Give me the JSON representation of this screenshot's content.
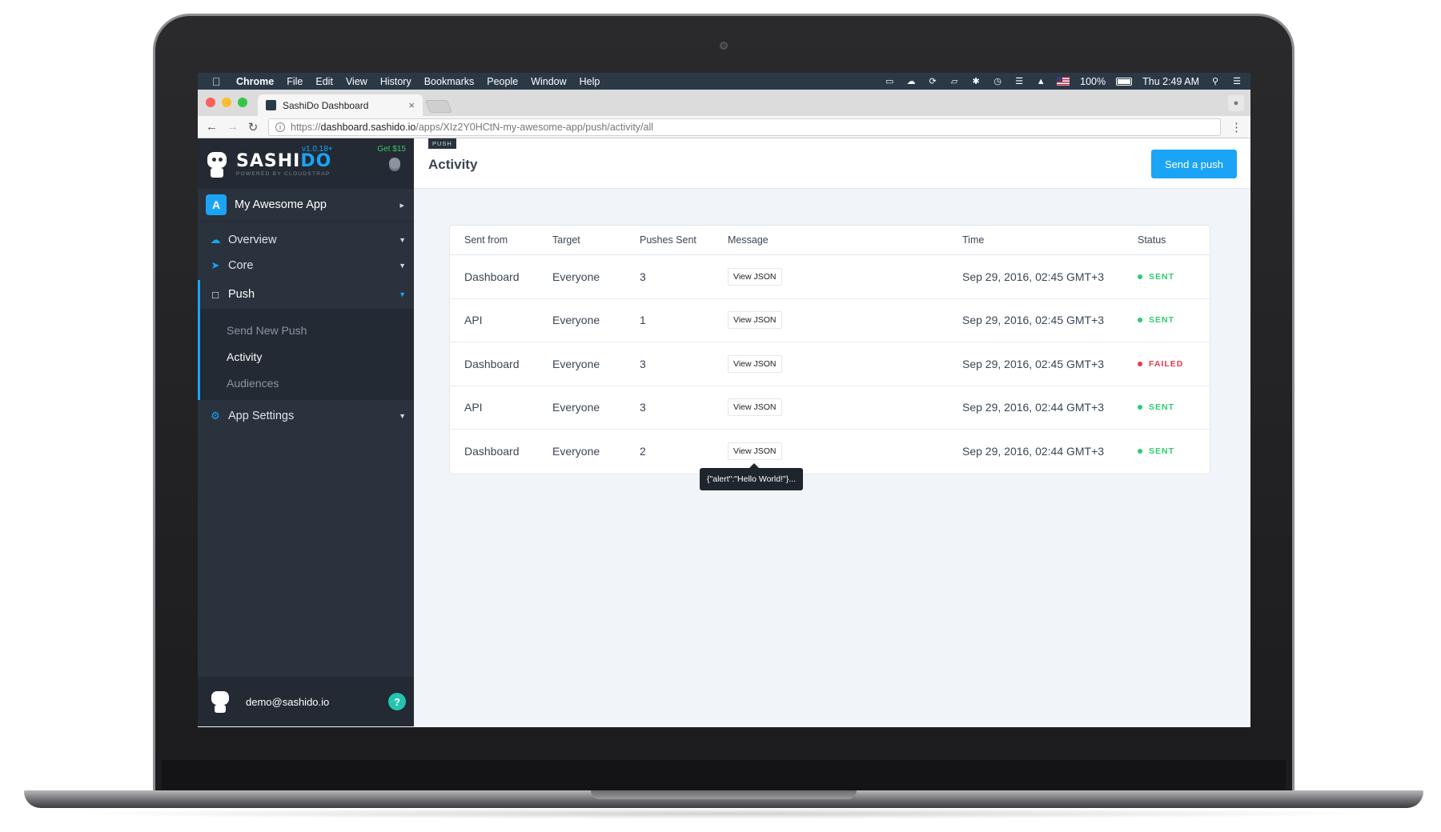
{
  "menubar": {
    "app": "Chrome",
    "items": [
      "File",
      "Edit",
      "View",
      "History",
      "Bookmarks",
      "People",
      "Window",
      "Help"
    ],
    "battery": "100%",
    "clock": "Thu 2:49 AM"
  },
  "browser": {
    "tab_title": "SashiDo Dashboard",
    "url_scheme": "https://",
    "url_host": "dashboard.sashido.io",
    "url_path": "/apps/XIz2Y0HCtN-my-awesome-app/push/activity/all"
  },
  "sidebar": {
    "brand": {
      "name_a": "SASHI",
      "name_b": "DO",
      "powered": "POWERED BY CLOUDSTRAP",
      "version": "v1.0.18+",
      "credit": "Get $15"
    },
    "app_name": "My Awesome App",
    "nav": [
      {
        "label": "Overview"
      },
      {
        "label": "Core"
      },
      {
        "label": "Push"
      },
      {
        "label": "App Settings"
      }
    ],
    "subnav": [
      {
        "label": "Send New Push"
      },
      {
        "label": "Activity"
      },
      {
        "label": "Audiences"
      }
    ],
    "user_email": "demo@sashido.io",
    "help": "?"
  },
  "header": {
    "section": "PUSH",
    "title": "Activity",
    "action": "Send a push"
  },
  "table": {
    "columns": [
      "Sent from",
      "Target",
      "Pushes Sent",
      "Message",
      "Time",
      "Status"
    ],
    "view_label": "View JSON",
    "rows": [
      {
        "from": "Dashboard",
        "target": "Everyone",
        "pushes": "3",
        "time": "Sep 29, 2016, 02:45 GMT+3",
        "status": "SENT"
      },
      {
        "from": "API",
        "target": "Everyone",
        "pushes": "1",
        "time": "Sep 29, 2016, 02:45 GMT+3",
        "status": "SENT"
      },
      {
        "from": "Dashboard",
        "target": "Everyone",
        "pushes": "3",
        "time": "Sep 29, 2016, 02:45 GMT+3",
        "status": "FAILED"
      },
      {
        "from": "API",
        "target": "Everyone",
        "pushes": "3",
        "time": "Sep 29, 2016, 02:44 GMT+3",
        "status": "SENT"
      },
      {
        "from": "Dashboard",
        "target": "Everyone",
        "pushes": "2",
        "time": "Sep 29, 2016, 02:44 GMT+3",
        "status": "SENT"
      }
    ]
  },
  "tooltip": "{\"alert\":\"Hello World!\"}..."
}
